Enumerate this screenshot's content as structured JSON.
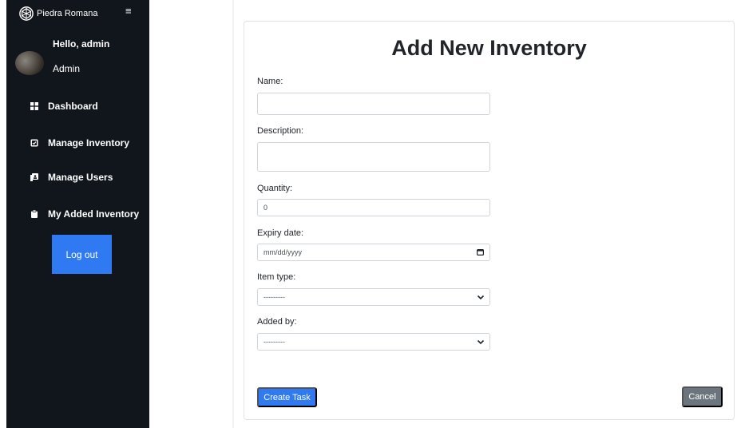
{
  "sidebar": {
    "brand": "Piedra Romana",
    "greeting": "Hello, admin",
    "role": "Admin",
    "items": [
      {
        "label": "Dashboard",
        "icon": "grid-icon"
      },
      {
        "label": "Manage Inventory",
        "icon": "check-square-icon"
      },
      {
        "label": "Manage Users",
        "icon": "user-card-icon"
      },
      {
        "label": "My Added Inventory",
        "icon": "clipboard-icon"
      }
    ],
    "logout_label": "Log out"
  },
  "form": {
    "title": "Add New Inventory",
    "name_label": "Name:",
    "name_value": "",
    "description_label": "Description:",
    "description_value": "",
    "quantity_label": "Quantity:",
    "quantity_value": "0",
    "expiry_label": "Expiry date:",
    "expiry_placeholder": "mm/dd/yyyy",
    "item_type_label": "Item type:",
    "item_type_selected": "---------",
    "added_by_label": "Added by:",
    "added_by_selected": "---------",
    "create_label": "Create Task",
    "cancel_label": "Cancel"
  },
  "colors": {
    "sidebar_bg": "#11151c",
    "primary": "#2f7af2",
    "secondary": "#6c757d"
  }
}
